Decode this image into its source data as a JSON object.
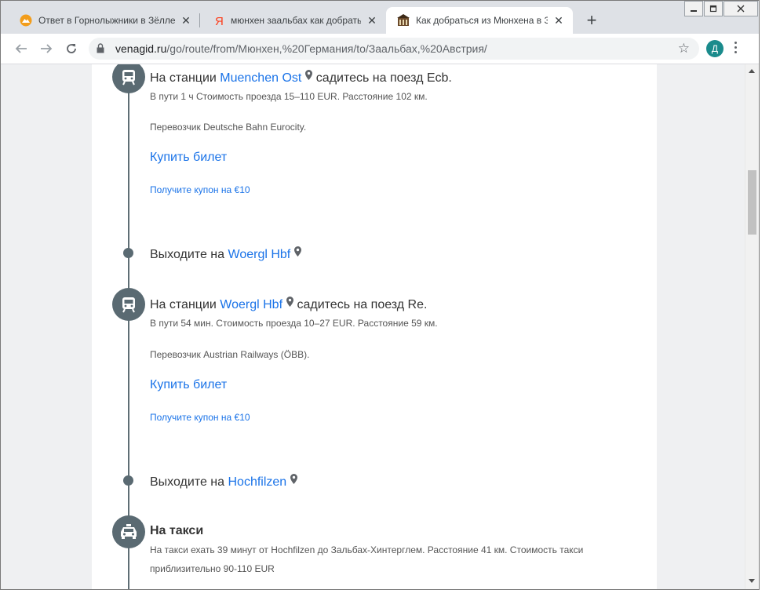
{
  "tabs": [
    {
      "title": "Ответ в Горнолыжники в Зёлле/S",
      "icon": "mountain-favicon-icon",
      "active": false
    },
    {
      "title": "мюнхен заальбах как добраться —",
      "icon": "yandex-favicon-icon",
      "active": false
    },
    {
      "title": "Как добраться из Мюнхена в Заал",
      "icon": "building-favicon-icon",
      "active": true
    }
  ],
  "toolbar": {
    "url_host": "venagid.ru",
    "url_path": "/go/route/from/Мюнхен,%20Германия/to/Заальбах,%20Австрия/",
    "avatar_letter": "Д"
  },
  "route": {
    "step1": {
      "prefix": "На станции",
      "station": "Muenchen Ost",
      "suffix": "садитесь на поезд Ecb.",
      "details": "В пути 1 ч Стоимость проезда 15–110 EUR. Расстояние 102 км.",
      "carrier": "Перевозчик Deutsche Bahn Eurocity.",
      "buy": "Купить билет",
      "coupon": "Получите купон на €10"
    },
    "exit1": {
      "prefix": "Выходите на",
      "station": "Woergl Hbf"
    },
    "step2": {
      "prefix": "На станции",
      "station": "Woergl Hbf",
      "suffix": "садитесь на поезд Re.",
      "details": "В пути 54 мин. Стоимость проезда 10–27 EUR. Расстояние 59 км.",
      "carrier": "Перевозчик Austrian Railways (ÖBB).",
      "buy": "Купить билет",
      "coupon": "Получите купон на €10"
    },
    "exit2": {
      "prefix": "Выходите на",
      "station": "Hochfilzen"
    },
    "taxi": {
      "title": "На такси",
      "details_line1": "На такси ехать 39 минут от Hochfilzen до Зальбах-Хинтерглем. Расстояние 41 км. Стоимость такси",
      "details_line2": "приблизительно 90-110 EUR"
    }
  },
  "colors": {
    "link": "#1a73e8",
    "timeline": "#5a6a72",
    "avatar": "#1a8b8c"
  }
}
